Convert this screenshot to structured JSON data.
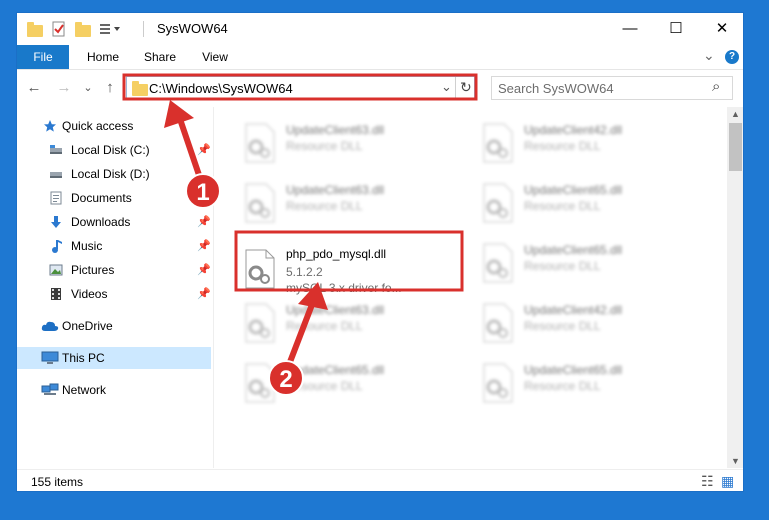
{
  "window": {
    "title": "SysWOW64",
    "minimize_glyph": "—",
    "maximize_glyph": "☐",
    "close_glyph": "✕"
  },
  "ribbon": {
    "tabs": [
      {
        "label": "File"
      },
      {
        "label": "Home"
      },
      {
        "label": "Share"
      },
      {
        "label": "View"
      }
    ],
    "expand_glyph": "⌄",
    "help_glyph": "?"
  },
  "addressbar": {
    "back_glyph": "←",
    "forward_glyph": "→",
    "recent_glyph": "⌄",
    "up_glyph": "↑",
    "path": "C:\\Windows\\SysWOW64",
    "dropdown_glyph": "⌄",
    "refresh_glyph": "↻"
  },
  "search": {
    "placeholder": "Search SysWOW64",
    "icon_glyph": "⌕"
  },
  "navpane": {
    "quick_access": "Quick access",
    "items": [
      {
        "label": "Local Disk (C:)",
        "icon": "drive-icon",
        "pinned": true
      },
      {
        "label": "Local Disk (D:)",
        "icon": "drive-icon",
        "pinned": false
      },
      {
        "label": "Documents",
        "icon": "documents-icon",
        "pinned": true
      },
      {
        "label": "Downloads",
        "icon": "downloads-icon",
        "pinned": true
      },
      {
        "label": "Music",
        "icon": "music-icon",
        "pinned": true
      },
      {
        "label": "Pictures",
        "icon": "pictures-icon",
        "pinned": true
      },
      {
        "label": "Videos",
        "icon": "videos-icon",
        "pinned": true
      }
    ],
    "onedrive": "OneDrive",
    "thispc": "This PC",
    "network": "Network",
    "pin_glyph": "📌"
  },
  "files": [
    {
      "name": "UpdateClient63.dll",
      "line2": "Resource DLL",
      "blurred": true
    },
    {
      "name": "UpdateClient42.dll",
      "line2": "Resource DLL",
      "blurred": true
    },
    {
      "name": "UpdateClient63.dll",
      "line2": "Resource DLL",
      "blurred": true
    },
    {
      "name": "UpdateClient65.dll",
      "line2": "Resource DLL",
      "blurred": true
    },
    {
      "name": "php_pdo_mysql.dll",
      "line2": "5.1.2.2",
      "line3": "mySQL 3.x driver fo...",
      "blurred": false
    },
    {
      "name": "UpdateClient65.dll",
      "line2": "Resource DLL",
      "blurred": true
    },
    {
      "name": "UpdateClient63.dll",
      "line2": "Resource DLL",
      "blurred": true
    },
    {
      "name": "UpdateClient42.dll",
      "line2": "Resource DLL",
      "blurred": true
    },
    {
      "name": "UpdateClient65.dll",
      "line2": "Resource DLL",
      "blurred": true
    },
    {
      "name": "UpdateClient65.dll",
      "line2": "Resource DLL",
      "blurred": true
    }
  ],
  "statusbar": {
    "item_count": "155 items",
    "details_view_glyph": "☷",
    "tiles_view_glyph": "▦"
  },
  "annotations": [
    {
      "label": "1"
    },
    {
      "label": "2"
    }
  ],
  "colors": {
    "accent": "#1979ca",
    "annotation_red": "#d9302c",
    "selection": "#cce8ff",
    "folder": "#f5cf63",
    "desktop": "#1e78d2"
  }
}
